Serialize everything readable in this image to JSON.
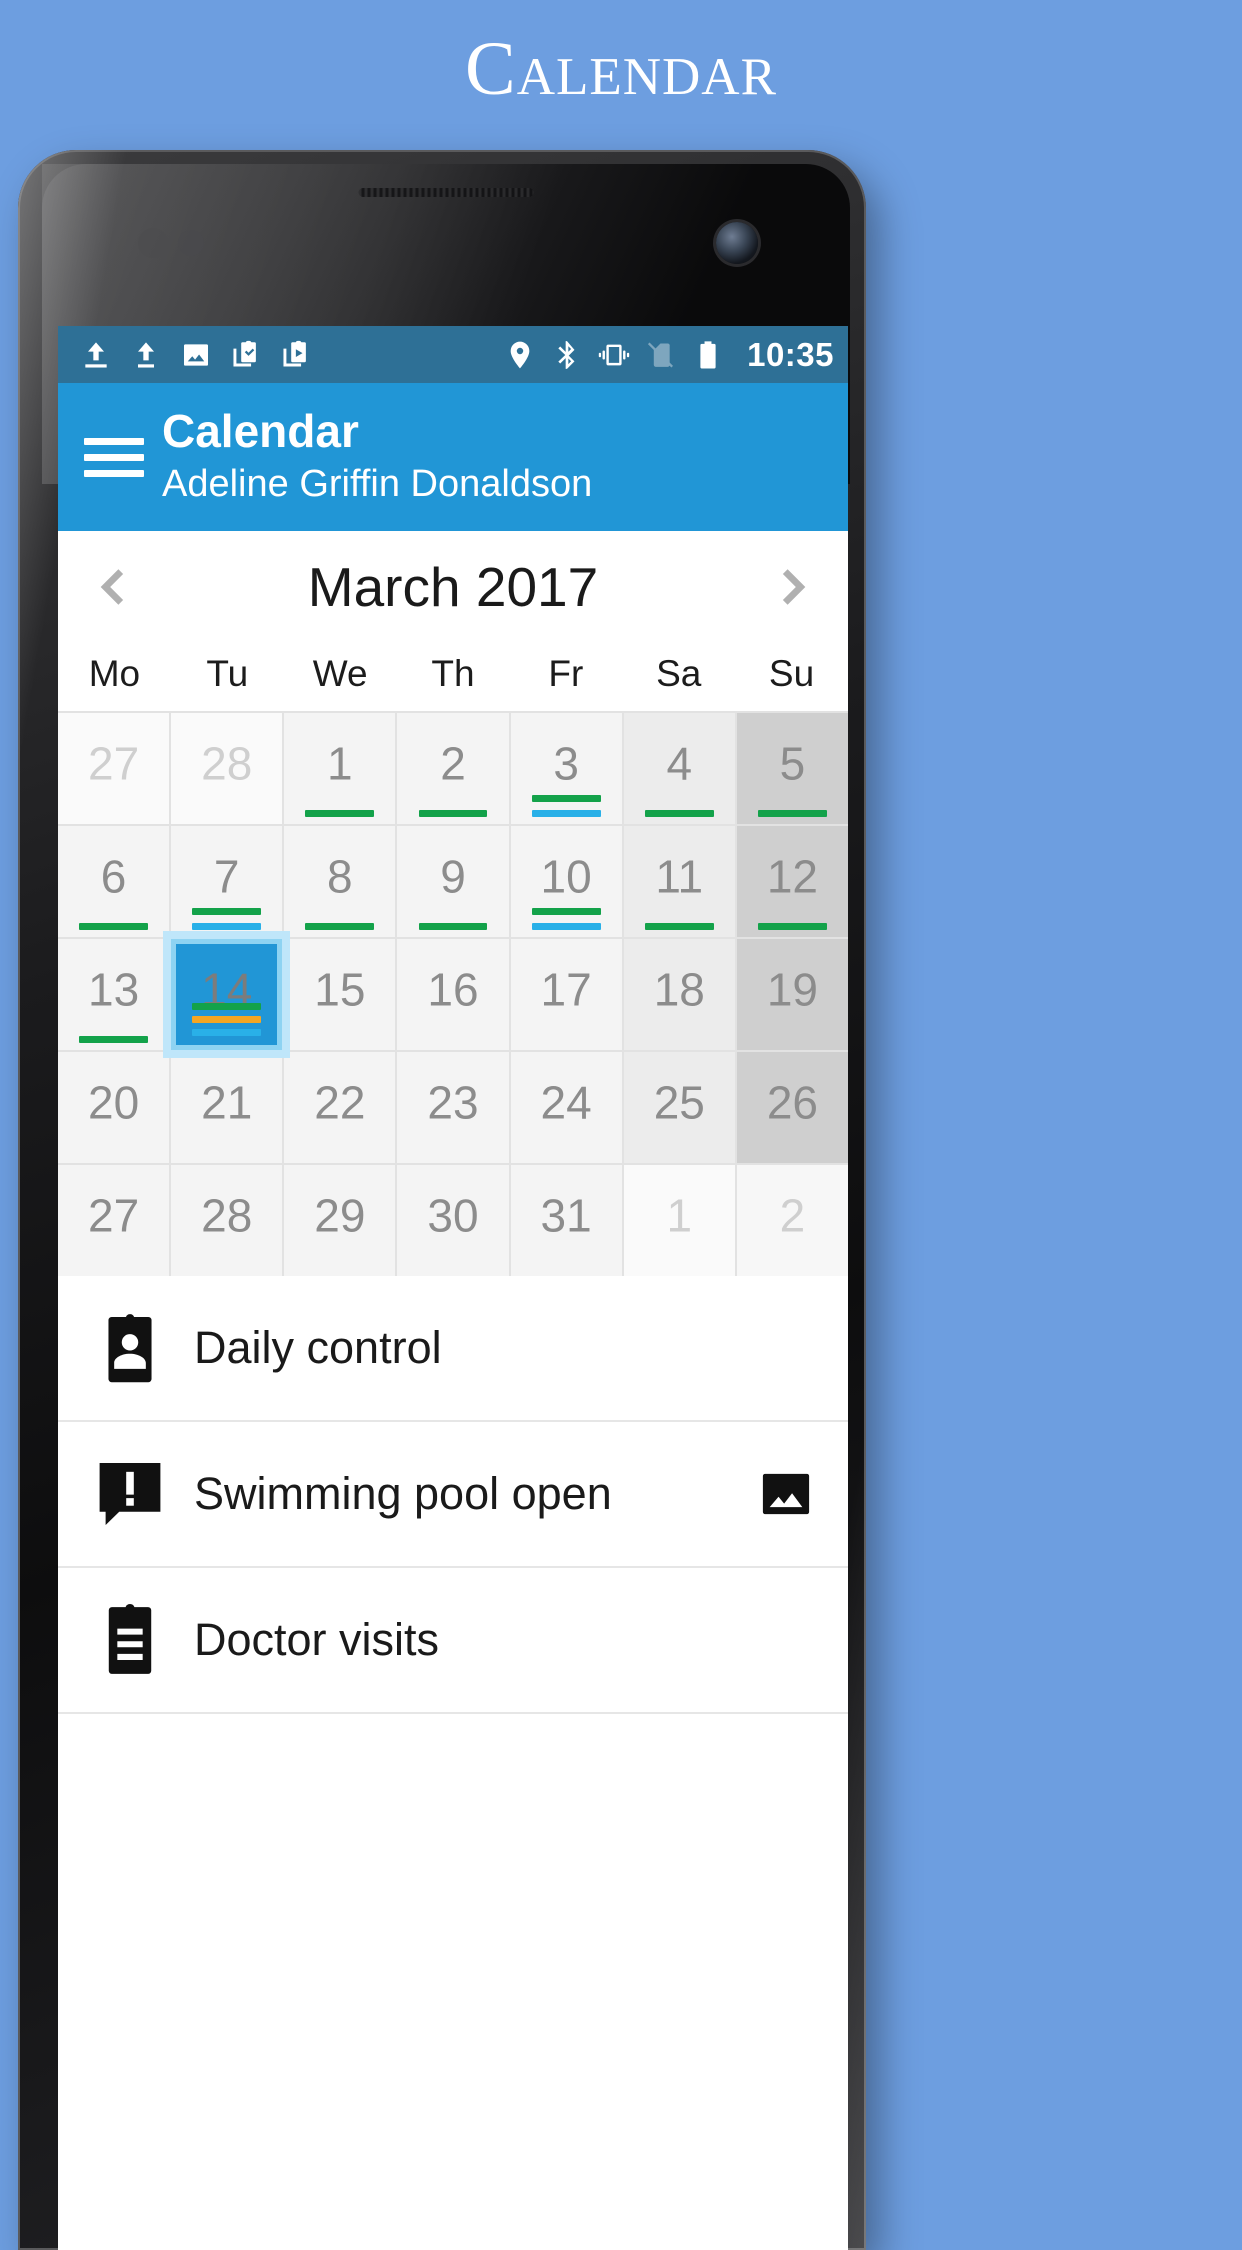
{
  "promo": {
    "title": "Calendar"
  },
  "status_bar": {
    "time": "10:35",
    "left_icons": [
      "upload-icon",
      "upload-icon",
      "image-icon",
      "clipboard-check-icon",
      "clipboard-play-icon"
    ],
    "right_icons": [
      "location-pin-icon",
      "bluetooth-icon",
      "vibrate-icon",
      "no-sim-icon",
      "battery-full-icon"
    ],
    "background": "#2e7096"
  },
  "app_bar": {
    "menu_icon": "hamburger-icon",
    "title": "Calendar",
    "subtitle": "Adeline Griffin Donaldson",
    "background": "#2196d6"
  },
  "month_nav": {
    "prev_label": "‹",
    "next_label": "›",
    "month_label": "March 2017"
  },
  "calendar": {
    "weekdays": [
      "Mo",
      "Tu",
      "We",
      "Th",
      "Fr",
      "Sa",
      "Su"
    ],
    "selected_day": 14,
    "colors": {
      "green": "#13a24a",
      "blue": "#29b0e8",
      "orange": "#f4a623",
      "selected": "#2196d6",
      "selected_glow": "#bfe6fa"
    },
    "weeks": [
      [
        {
          "day": "27",
          "other": true,
          "bars": []
        },
        {
          "day": "28",
          "other": true,
          "bars": []
        },
        {
          "day": "1",
          "other": false,
          "bars": [
            "green"
          ]
        },
        {
          "day": "2",
          "other": false,
          "bars": [
            "green"
          ]
        },
        {
          "day": "3",
          "other": false,
          "bars": [
            "green",
            "blue"
          ]
        },
        {
          "day": "4",
          "other": false,
          "bars": [
            "green"
          ]
        },
        {
          "day": "5",
          "other": false,
          "bars": [
            "green"
          ]
        }
      ],
      [
        {
          "day": "6",
          "other": false,
          "bars": [
            "green"
          ]
        },
        {
          "day": "7",
          "other": false,
          "bars": [
            "green",
            "blue"
          ]
        },
        {
          "day": "8",
          "other": false,
          "bars": [
            "green"
          ]
        },
        {
          "day": "9",
          "other": false,
          "bars": [
            "green"
          ]
        },
        {
          "day": "10",
          "other": false,
          "bars": [
            "green",
            "blue"
          ]
        },
        {
          "day": "11",
          "other": false,
          "bars": [
            "green"
          ]
        },
        {
          "day": "12",
          "other": false,
          "bars": [
            "green"
          ]
        }
      ],
      [
        {
          "day": "13",
          "other": false,
          "bars": [
            "green"
          ]
        },
        {
          "day": "14",
          "other": false,
          "bars": [
            "green",
            "orange",
            "blue"
          ],
          "selected": true
        },
        {
          "day": "15",
          "other": false,
          "bars": []
        },
        {
          "day": "16",
          "other": false,
          "bars": []
        },
        {
          "day": "17",
          "other": false,
          "bars": []
        },
        {
          "day": "18",
          "other": false,
          "bars": []
        },
        {
          "day": "19",
          "other": false,
          "bars": []
        }
      ],
      [
        {
          "day": "20",
          "other": false,
          "bars": []
        },
        {
          "day": "21",
          "other": false,
          "bars": []
        },
        {
          "day": "22",
          "other": false,
          "bars": []
        },
        {
          "day": "23",
          "other": false,
          "bars": []
        },
        {
          "day": "24",
          "other": false,
          "bars": []
        },
        {
          "day": "25",
          "other": false,
          "bars": []
        },
        {
          "day": "26",
          "other": false,
          "bars": []
        }
      ],
      [
        {
          "day": "27",
          "other": false,
          "bars": []
        },
        {
          "day": "28",
          "other": false,
          "bars": []
        },
        {
          "day": "29",
          "other": false,
          "bars": []
        },
        {
          "day": "30",
          "other": false,
          "bars": []
        },
        {
          "day": "31",
          "other": false,
          "bars": []
        },
        {
          "day": "1",
          "other": true,
          "bars": []
        },
        {
          "day": "2",
          "other": true,
          "bars": []
        }
      ]
    ]
  },
  "events": [
    {
      "label": "Daily control",
      "icon": "person-badge-icon",
      "trailing_icon": null
    },
    {
      "label": "Swimming pool open",
      "icon": "alert-speech-bubble-icon",
      "trailing_icon": "image-icon"
    },
    {
      "label": "Doctor visits",
      "icon": "clipboard-list-icon",
      "trailing_icon": null
    }
  ]
}
